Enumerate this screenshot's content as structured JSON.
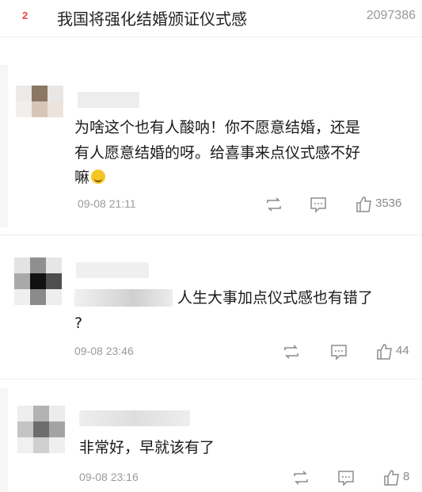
{
  "topic": {
    "rank": "2",
    "title": "我国将强化结婚颁证仪式感",
    "heat": "2097386"
  },
  "comments": [
    {
      "line1": "为啥这个也有人酸呐！你不愿意结婚，还是",
      "line2": "有人愿意结婚的呀。给喜事来点仪式感不好",
      "line3": "嘛",
      "emoji": "laughing-tears-emoji",
      "time": "09-08 21:11",
      "likes": "3536"
    },
    {
      "line1": "人生大事加点仪式感也有错了",
      "line2": "?",
      "time": "09-08 23:46",
      "likes": "44"
    },
    {
      "line1": "非常好，早就该有了",
      "time": "09-08 23:16",
      "likes": "8"
    }
  ],
  "icons": {
    "repost": "repost-icon",
    "comment": "comment-icon",
    "like": "thumbs-up-icon"
  },
  "colors": {
    "rank": "#e8453c",
    "meta_text": "#9a9a9a"
  }
}
